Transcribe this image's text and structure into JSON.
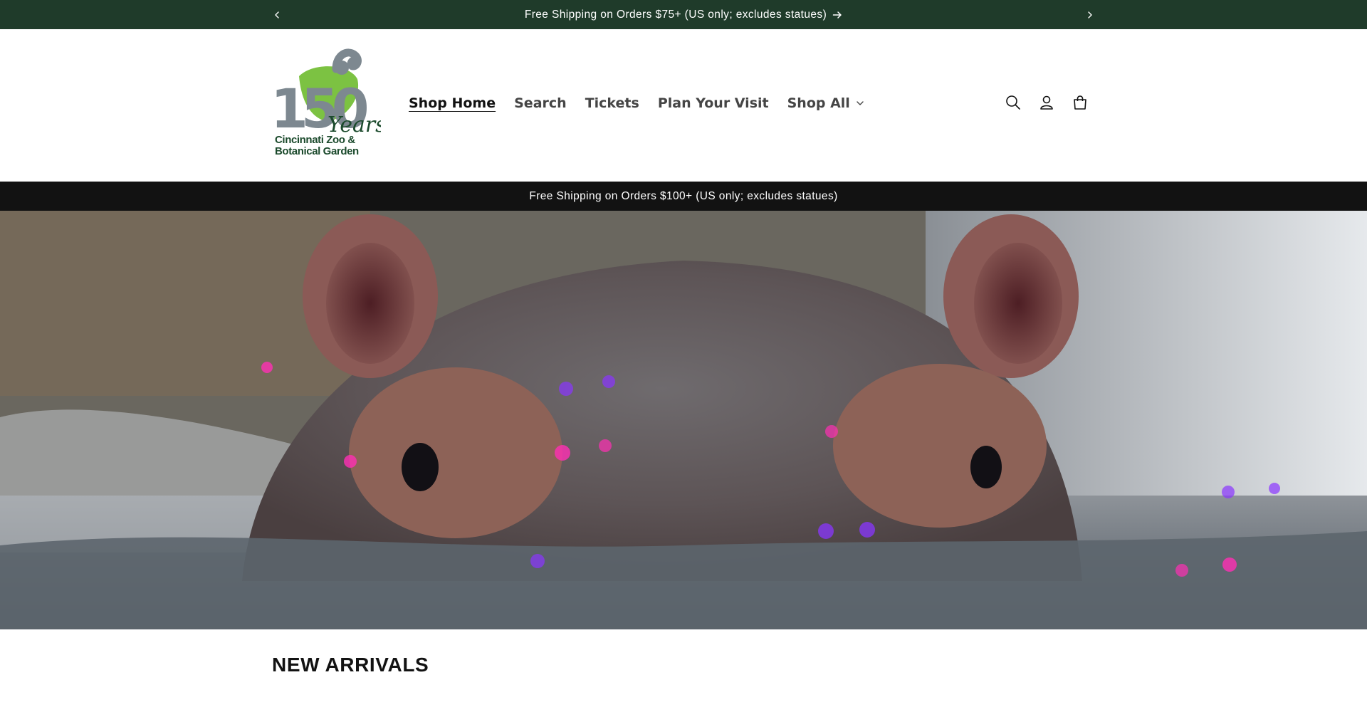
{
  "announcement_top": {
    "message": "Free Shipping on Orders $75+ (US only; excludes statues)",
    "prev_icon": "chevron-left-icon",
    "next_icon": "chevron-right-icon",
    "arrow_icon": "arrow-right-icon",
    "background": "#1f3b2a"
  },
  "header": {
    "logo": {
      "badge_text": "150",
      "script_text": "Years",
      "wordmark_line1": "Cincinnati Zoo &",
      "wordmark_line2": "Botanical Garden"
    },
    "nav": [
      {
        "label": "Shop Home",
        "active": true
      },
      {
        "label": "Search"
      },
      {
        "label": "Tickets"
      },
      {
        "label": "Plan Your Visit"
      },
      {
        "label": "Shop All",
        "has_dropdown": true
      }
    ],
    "icons": [
      "search-icon",
      "account-icon",
      "cart-icon"
    ]
  },
  "announcement_secondary": {
    "message": "Free Shipping on Orders $100+ (US only; excludes statues)",
    "background": "#121212"
  },
  "hero": {
    "image_subject": "hippo-in-water"
  },
  "sections": {
    "new_arrivals_title": "NEW ARRIVALS"
  }
}
